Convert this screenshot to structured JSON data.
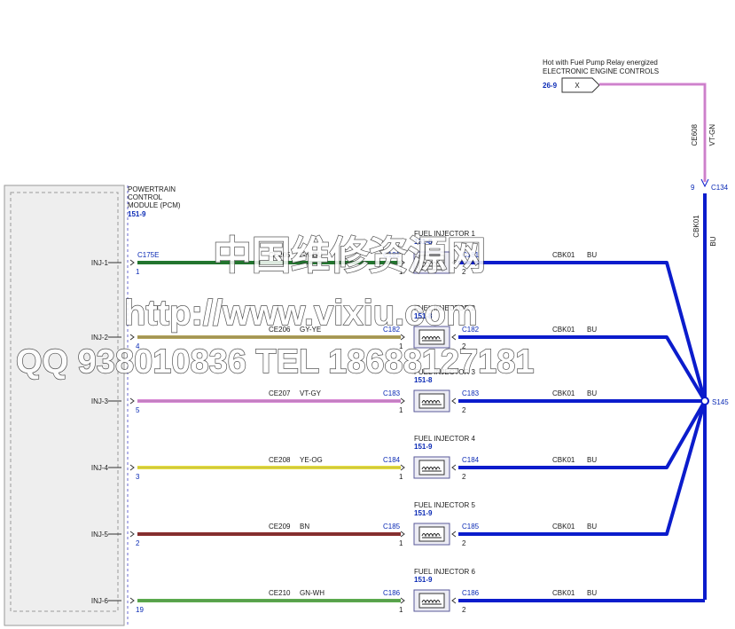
{
  "header": {
    "hot_label": "Hot with Fuel Pump Relay energized",
    "system_label": "ELECTRONIC ENGINE CONTROLS",
    "ref": "26-9",
    "conn_pin": "X",
    "feed_circuit": "CE608",
    "feed_color": "VT-GN",
    "c134_pin": "9",
    "c134": "C134",
    "bus_circuit": "CBK01",
    "bus_color": "BU",
    "splice": "S145"
  },
  "pcm": {
    "line1": "POWERTRAIN",
    "line2": "CONTROL",
    "line3": "MODULE (PCM)",
    "ref": "151-9",
    "connector": "C175E"
  },
  "injectors": [
    {
      "pcm_pin_label": "INJ-1",
      "pcm_pin": "1",
      "circuit": "CE205",
      "color_code": "GN-BU",
      "conn": "C181",
      "name": "FUEL INJECTOR 1",
      "ref": "151-8",
      "pin_in": "1",
      "pin_out": "2",
      "out_circuit": "CBK01",
      "out_color": "BU",
      "wire_color": "#1f7a2c"
    },
    {
      "pcm_pin_label": "INJ-2",
      "pcm_pin": "4",
      "circuit": "CE206",
      "color_code": "GY-YE",
      "conn": "C182",
      "name": "FUEL INJECTOR 2",
      "ref": "151-8",
      "pin_in": "1",
      "pin_out": "2",
      "out_circuit": "CBK01",
      "out_color": "BU",
      "wire_color": "#b3a35a"
    },
    {
      "pcm_pin_label": "INJ-3",
      "pcm_pin": "5",
      "circuit": "CE207",
      "color_code": "VT-GY",
      "conn": "C183",
      "name": "FUEL INJECTOR 3",
      "ref": "151-8",
      "pin_in": "1",
      "pin_out": "2",
      "out_circuit": "CBK01",
      "out_color": "BU",
      "wire_color": "#d98ad6"
    },
    {
      "pcm_pin_label": "INJ-4",
      "pcm_pin": "3",
      "circuit": "CE208",
      "color_code": "YE-OG",
      "conn": "C184",
      "name": "FUEL INJECTOR 4",
      "ref": "151-9",
      "pin_in": "1",
      "pin_out": "2",
      "out_circuit": "CBK01",
      "out_color": "BU",
      "wire_color": "#e8e040"
    },
    {
      "pcm_pin_label": "INJ-5",
      "pcm_pin": "2",
      "circuit": "CE209",
      "color_code": "BN",
      "conn": "C185",
      "name": "FUEL INJECTOR 5",
      "ref": "151-9",
      "pin_in": "1",
      "pin_out": "2",
      "out_circuit": "CBK01",
      "out_color": "BU",
      "wire_color": "#8c2c2c"
    },
    {
      "pcm_pin_label": "INJ-6",
      "pcm_pin": "19",
      "circuit": "CE210",
      "color_code": "GN-WH",
      "conn": "C186",
      "name": "FUEL INJECTOR 6",
      "ref": "151-9",
      "pin_in": "1",
      "pin_out": "2",
      "out_circuit": "CBK01",
      "out_color": "BU",
      "wire_color": "#5cae4e"
    }
  ],
  "watermark": {
    "line1": "中国维修资源网",
    "line2": "http://www.vixiu.com",
    "line3": "QQ 938010836 TEL 18688127181"
  },
  "colors": {
    "bus": "#0b1ccc",
    "feed": "#d98ad6",
    "label_blue": "#0a2ab5",
    "pcm_border": "#aaaaaa"
  }
}
